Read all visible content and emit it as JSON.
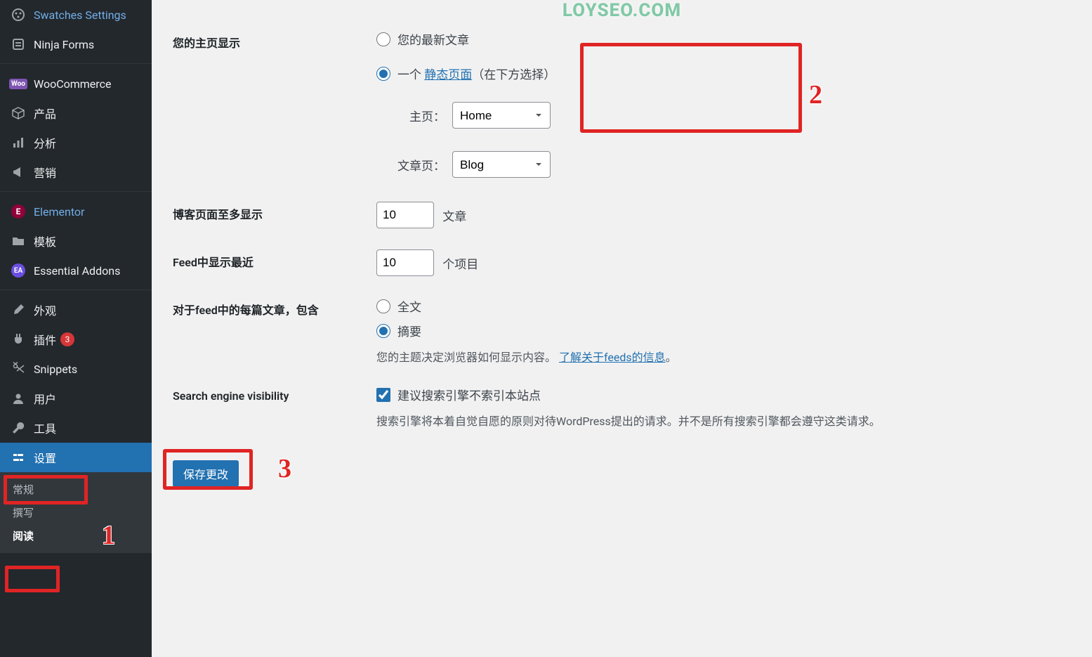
{
  "watermark": "LOYSEO.COM",
  "sidebar": {
    "items": [
      {
        "label": "Swatches Settings",
        "icon": "palette"
      },
      {
        "label": "Ninja Forms",
        "icon": "form"
      },
      {
        "sep": true
      },
      {
        "label": "WooCommerce",
        "icon": "woo"
      },
      {
        "label": "产品",
        "icon": "box"
      },
      {
        "label": "分析",
        "icon": "stats"
      },
      {
        "label": "营销",
        "icon": "megaphone"
      },
      {
        "sep": true
      },
      {
        "label": "Elementor",
        "icon": "elementor",
        "highlight": true
      },
      {
        "label": "模板",
        "icon": "folder"
      },
      {
        "label": "Essential Addons",
        "icon": "ea"
      },
      {
        "sep": true
      },
      {
        "label": "外观",
        "icon": "brush"
      },
      {
        "label": "插件",
        "icon": "plug",
        "badge": "3"
      },
      {
        "label": "Snippets",
        "icon": "scissors"
      },
      {
        "label": "用户",
        "icon": "user"
      },
      {
        "label": "工具",
        "icon": "wrench"
      },
      {
        "label": "设置",
        "icon": "settings",
        "active": true
      }
    ],
    "sub": [
      "常规",
      "撰写",
      "阅读"
    ],
    "sub_current": "阅读"
  },
  "form": {
    "homepage": {
      "heading": "您的主页显示",
      "opt_latest": "您的最新文章",
      "opt_static_prefix": "一个 ",
      "opt_static_link": "静态页面",
      "opt_static_suffix": "（在下方选择）",
      "home_label": "主页：",
      "home_value": "Home",
      "posts_label": "文章页：",
      "posts_value": "Blog"
    },
    "blog_limit": {
      "heading": "博客页面至多显示",
      "value": "10",
      "unit": "文章"
    },
    "feed_limit": {
      "heading": "Feed中显示最近",
      "value": "10",
      "unit": "个项目"
    },
    "feed_content": {
      "heading": "对于feed中的每篇文章，包含",
      "opt_full": "全文",
      "opt_summary": "摘要",
      "desc_prefix": "您的主题决定浏览器如何显示内容。",
      "desc_link": "了解关于feeds的信息",
      "desc_suffix": "。"
    },
    "seo": {
      "heading": "Search engine visibility",
      "checkbox": "建议搜索引擎不索引本站点",
      "desc": "搜索引擎将本着自觉自愿的原则对待WordPress提出的请求。并不是所有搜索引擎都会遵守这类请求。"
    },
    "save": "保存更改"
  },
  "annotations": {
    "n1": "1",
    "n2": "2",
    "n3": "3"
  }
}
